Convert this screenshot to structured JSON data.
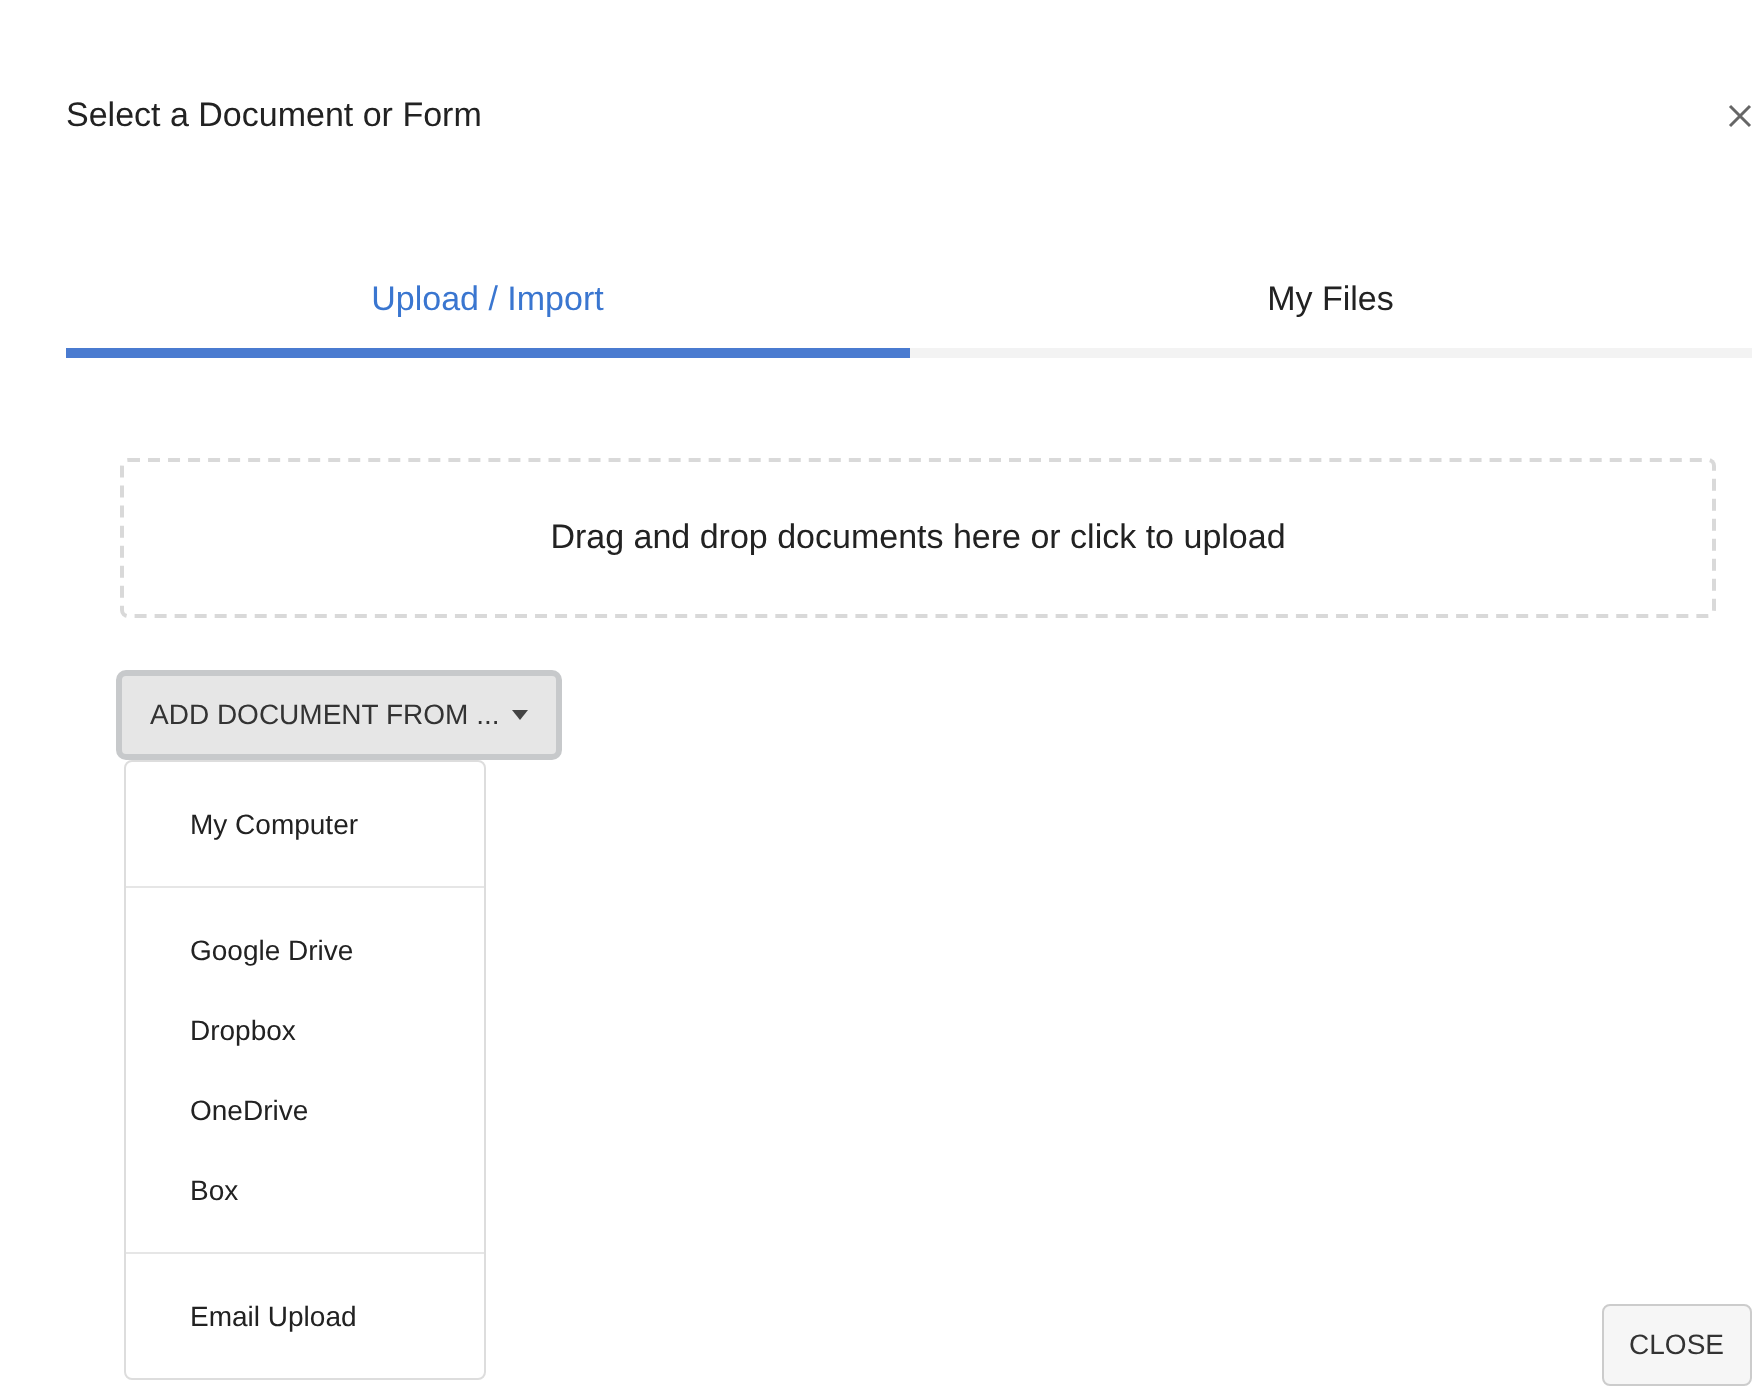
{
  "dialog": {
    "title": "Select a Document or Form"
  },
  "tabs": [
    {
      "label": "Upload / Import",
      "selected": true
    },
    {
      "label": "My Files",
      "selected": false
    }
  ],
  "dropzone": {
    "text": "Drag and drop documents here or click to upload"
  },
  "add_button": {
    "label": "ADD DOCUMENT FROM ...",
    "expanded": true
  },
  "menu": {
    "groups": [
      [
        "My Computer"
      ],
      [
        "Google Drive",
        "Dropbox",
        "OneDrive",
        "Box"
      ],
      [
        "Email Upload"
      ]
    ]
  },
  "footer_button": {
    "label": "CLOSE"
  }
}
